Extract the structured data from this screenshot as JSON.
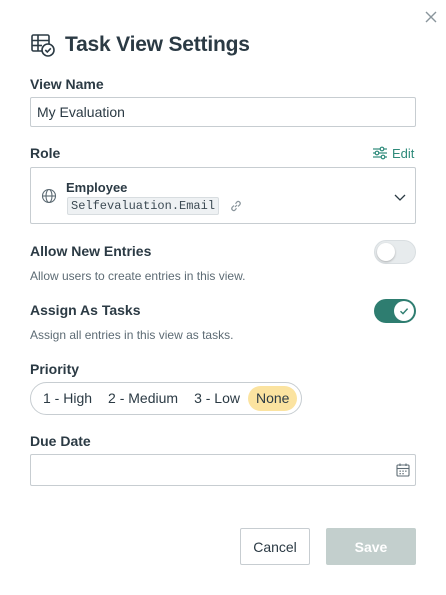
{
  "dialog": {
    "title": "Task View Settings",
    "close_icon": "close-icon",
    "title_icon": "table-check-icon"
  },
  "view_name": {
    "label": "View Name",
    "value": "My Evaluation"
  },
  "role": {
    "label": "Role",
    "edit_label": "Edit",
    "name": "Employee",
    "expression": "Selfevaluation.Email",
    "icons": [
      "globe-icon",
      "link-icon",
      "chevron-down-icon",
      "sliders-icon"
    ]
  },
  "allow_new_entries": {
    "label": "Allow New Entries",
    "description": "Allow users to create entries in this view.",
    "enabled": false
  },
  "assign_as_tasks": {
    "label": "Assign As Tasks",
    "description": "Assign all entries in this view as tasks.",
    "enabled": true
  },
  "priority": {
    "label": "Priority",
    "options": [
      "1 - High",
      "2 - Medium",
      "3 - Low",
      "None"
    ],
    "selected": "None"
  },
  "due_date": {
    "label": "Due Date",
    "value": "",
    "icon": "calendar-icon"
  },
  "footer": {
    "cancel_label": "Cancel",
    "save_label": "Save"
  },
  "colors": {
    "accent": "#2e7d70",
    "link": "#2e8a7a",
    "priority_selected": "#fbe3a0",
    "save_disabled": "#c3cfcd",
    "text": "#2b3a44"
  }
}
